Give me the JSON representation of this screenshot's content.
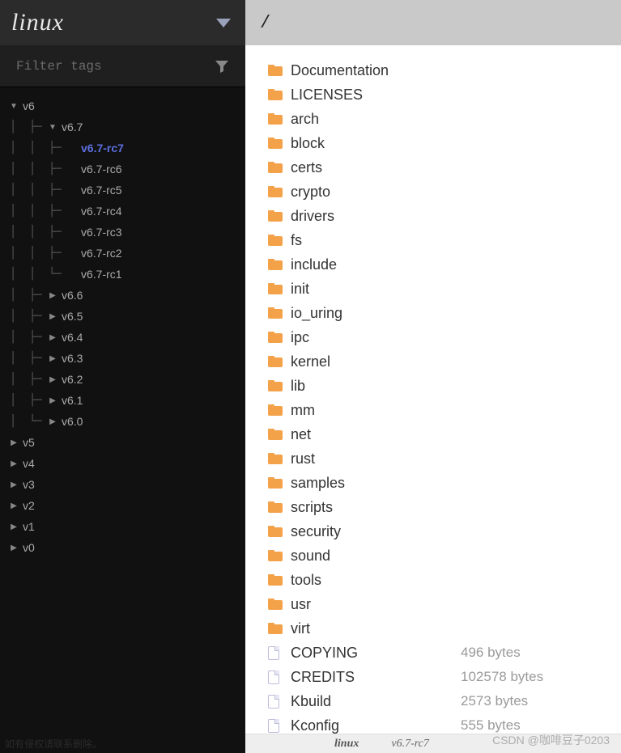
{
  "sidebar": {
    "title": "linux",
    "filter_placeholder": "Filter tags",
    "tree": [
      {
        "label": "v6",
        "expanded": true,
        "children": [
          {
            "label": "v6.7",
            "expanded": true,
            "children": [
              {
                "label": "v6.7-rc7",
                "selected": true
              },
              {
                "label": "v6.7-rc6"
              },
              {
                "label": "v6.7-rc5"
              },
              {
                "label": "v6.7-rc4"
              },
              {
                "label": "v6.7-rc3"
              },
              {
                "label": "v6.7-rc2"
              },
              {
                "label": "v6.7-rc1"
              }
            ]
          },
          {
            "label": "v6.6"
          },
          {
            "label": "v6.5"
          },
          {
            "label": "v6.4"
          },
          {
            "label": "v6.3"
          },
          {
            "label": "v6.2"
          },
          {
            "label": "v6.1"
          },
          {
            "label": "v6.0"
          }
        ]
      },
      {
        "label": "v5"
      },
      {
        "label": "v4"
      },
      {
        "label": "v3"
      },
      {
        "label": "v2"
      },
      {
        "label": "v1"
      },
      {
        "label": "v0"
      }
    ]
  },
  "main": {
    "path": "/",
    "entries": [
      {
        "type": "dir",
        "name": "Documentation"
      },
      {
        "type": "dir",
        "name": "LICENSES"
      },
      {
        "type": "dir",
        "name": "arch"
      },
      {
        "type": "dir",
        "name": "block"
      },
      {
        "type": "dir",
        "name": "certs"
      },
      {
        "type": "dir",
        "name": "crypto"
      },
      {
        "type": "dir",
        "name": "drivers"
      },
      {
        "type": "dir",
        "name": "fs"
      },
      {
        "type": "dir",
        "name": "include"
      },
      {
        "type": "dir",
        "name": "init"
      },
      {
        "type": "dir",
        "name": "io_uring"
      },
      {
        "type": "dir",
        "name": "ipc"
      },
      {
        "type": "dir",
        "name": "kernel"
      },
      {
        "type": "dir",
        "name": "lib"
      },
      {
        "type": "dir",
        "name": "mm"
      },
      {
        "type": "dir",
        "name": "net"
      },
      {
        "type": "dir",
        "name": "rust"
      },
      {
        "type": "dir",
        "name": "samples"
      },
      {
        "type": "dir",
        "name": "scripts"
      },
      {
        "type": "dir",
        "name": "security"
      },
      {
        "type": "dir",
        "name": "sound"
      },
      {
        "type": "dir",
        "name": "tools"
      },
      {
        "type": "dir",
        "name": "usr"
      },
      {
        "type": "dir",
        "name": "virt"
      },
      {
        "type": "file",
        "name": "COPYING",
        "size": "496 bytes"
      },
      {
        "type": "file",
        "name": "CREDITS",
        "size": "102578 bytes"
      },
      {
        "type": "file",
        "name": "Kbuild",
        "size": "2573 bytes"
      },
      {
        "type": "file",
        "name": "Kconfig",
        "size": "555 bytes"
      }
    ]
  },
  "status": {
    "project": "linux",
    "tag": "v6.7-rc7"
  },
  "watermark": "CSDN @咖啡豆子0203",
  "faded": "如有侵权请联系删除。"
}
